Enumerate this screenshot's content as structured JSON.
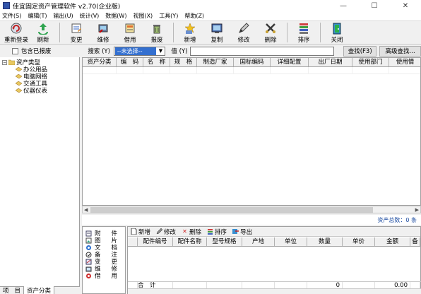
{
  "window": {
    "title": "佳宜固定资产管理软件 v2.70(企业版)",
    "minimize": "—",
    "maximize": "☐",
    "close": "✕"
  },
  "menu": [
    "文件(S)",
    "编辑(T)",
    "输出(U)",
    "统计(V)",
    "数据(W)",
    "视图(X)",
    "工具(Y)",
    "帮助(Z)"
  ],
  "toolbar": {
    "relogin": "重新登录",
    "refresh": "刷新",
    "change": "变更",
    "repair": "维修",
    "borrow": "借用",
    "scrap": "报废",
    "add": "新增",
    "copy": "复制",
    "edit": "修改",
    "delete": "删除",
    "sort": "排序",
    "close": "关闭"
  },
  "search": {
    "include_scrapped": "包含已报废",
    "search_label": "搜索 (Y)",
    "select_value": "--未选择--",
    "value_label": "值 (Y)",
    "value_input": "",
    "find_button": "查找(F3)",
    "advanced_button": "高级查找..."
  },
  "tree": {
    "root": "资产类型",
    "children": [
      "办公用品",
      "电脑网络",
      "交通工具",
      "仪器仪表"
    ]
  },
  "left_tabs": [
    "项",
    "目",
    "资产分类"
  ],
  "grid": {
    "columns": [
      "资产分类",
      "编　码",
      "名　称",
      "规　格",
      "制造厂家",
      "国标编码",
      "详细配置",
      "出厂日期",
      "使用部门",
      "使用情"
    ]
  },
  "status": {
    "total": "资产总数：0 条"
  },
  "attachments": {
    "items": [
      "附件",
      "图片",
      "文档",
      "备注",
      "变更",
      "维修",
      "借用"
    ]
  },
  "sub_toolbar": {
    "add": "新增",
    "edit": "修改",
    "delete": "删除",
    "sort": "排序",
    "export": "导出"
  },
  "sub_grid": {
    "columns": [
      "配件编号",
      "配件名称",
      "型号规格",
      "产地",
      "单位",
      "数量",
      "单价",
      "金额",
      "备"
    ],
    "total_label": "合　计",
    "total_qty": "0",
    "total_amount": "0.00"
  },
  "colors": {
    "accent": "#3470d0",
    "status_text": "#1a4aa0",
    "folder": "#e8c860"
  }
}
